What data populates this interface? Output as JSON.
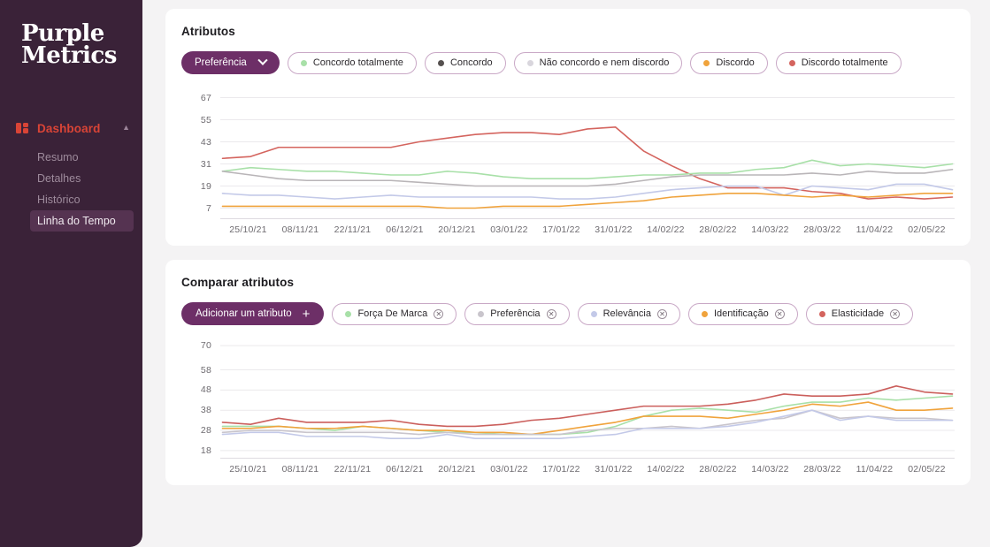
{
  "sidebar": {
    "logo_line1": "Purple",
    "logo_line2": "Metrics",
    "nav": {
      "group_label": "Dashboard",
      "group_icon": "grid-icon",
      "chevron_icon": "chevron-up-icon",
      "items": [
        {
          "label": "Resumo",
          "active": false
        },
        {
          "label": "Detalhes",
          "active": false
        },
        {
          "label": "Histórico",
          "active": false
        },
        {
          "label": "Linha do Tempo",
          "active": true
        }
      ]
    }
  },
  "cards": [
    {
      "title": "Atributos",
      "selector": {
        "label": "Preferência",
        "icon": "chevron-down-icon"
      },
      "legend": [
        {
          "label": "Concordo totalmente",
          "color": "#a8e0a8"
        },
        {
          "label": "Concordo",
          "color": "#55504f"
        },
        {
          "label": "Não concordo e nem discordo",
          "color": "#d9d6dd"
        },
        {
          "label": "Discordo",
          "color": "#f0a33c"
        },
        {
          "label": "Discordo totalmente",
          "color": "#d4645e"
        }
      ]
    },
    {
      "title": "Comparar atributos",
      "selector": {
        "label": "Adicionar um atributo",
        "icon": "plus-icon"
      },
      "legend": [
        {
          "label": "Força De Marca",
          "color": "#a8e0a8",
          "remove_icon": "remove-circle-icon"
        },
        {
          "label": "Preferência",
          "color": "#c9c5cc",
          "remove_icon": "remove-circle-icon"
        },
        {
          "label": "Relevância",
          "color": "#c3c9e8",
          "remove_icon": "remove-circle-icon"
        },
        {
          "label": "Identificação",
          "color": "#f0a33c",
          "remove_icon": "remove-circle-icon"
        },
        {
          "label": "Elasticidade",
          "color": "#d4645e",
          "remove_icon": "remove-circle-icon"
        }
      ]
    }
  ],
  "chart_data": [
    {
      "type": "line",
      "title": "Atributos",
      "xlabel": "",
      "ylabel": "",
      "grid": true,
      "legend_position": "top",
      "yticks": [
        67,
        55,
        43,
        31,
        19,
        7
      ],
      "ylim": [
        1,
        73
      ],
      "x": [
        "25/10/21",
        "01/11/21",
        "08/11/21",
        "15/11/21",
        "22/11/21",
        "29/11/21",
        "06/12/21",
        "13/12/21",
        "20/12/21",
        "27/12/21",
        "03/01/22",
        "10/01/22",
        "17/01/22",
        "24/01/22",
        "31/01/22",
        "07/02/22",
        "14/02/22",
        "21/02/22",
        "28/02/22",
        "07/03/22",
        "14/03/22",
        "21/03/22",
        "28/03/22",
        "04/04/22",
        "11/04/22",
        "18/04/22",
        "02/05/22"
      ],
      "xtick_labels": [
        "25/10/21",
        "08/11/21",
        "22/11/21",
        "06/12/21",
        "20/12/21",
        "03/01/22",
        "17/01/22",
        "31/01/22",
        "14/02/22",
        "28/02/22",
        "14/03/22",
        "28/03/22",
        "11/04/22",
        "02/05/22"
      ],
      "series": [
        {
          "name": "Discordo totalmente",
          "color": "#d4645e",
          "values": [
            34,
            35,
            40,
            40,
            40,
            40,
            40,
            43,
            45,
            47,
            48,
            48,
            47,
            50,
            51,
            38,
            30,
            23,
            18,
            18,
            18,
            16,
            15,
            12,
            13,
            12,
            13
          ]
        },
        {
          "name": "Concordo totalmente",
          "color": "#a8e0a8",
          "values": [
            27,
            29,
            28,
            27,
            27,
            26,
            25,
            25,
            27,
            26,
            24,
            23,
            23,
            23,
            24,
            25,
            25,
            26,
            26,
            28,
            29,
            33,
            30,
            31,
            30,
            29,
            31
          ]
        },
        {
          "name": "Concordo",
          "color": "#b9b5b8",
          "values": [
            27,
            25,
            23,
            22,
            22,
            22,
            22,
            21,
            20,
            19,
            19,
            19,
            19,
            19,
            20,
            22,
            24,
            25,
            25,
            25,
            25,
            26,
            25,
            27,
            26,
            26,
            28
          ]
        },
        {
          "name": "Não concordo e nem discordo",
          "color": "#c3c9e8",
          "values": [
            15,
            14,
            14,
            13,
            12,
            13,
            14,
            13,
            13,
            13,
            13,
            13,
            12,
            12,
            13,
            15,
            17,
            18,
            19,
            19,
            14,
            19,
            18,
            17,
            20,
            20,
            17
          ]
        },
        {
          "name": "Discordo",
          "color": "#f0a33c",
          "values": [
            8,
            8,
            8,
            8,
            8,
            8,
            8,
            8,
            7,
            7,
            8,
            8,
            8,
            9,
            10,
            11,
            13,
            14,
            15,
            15,
            14,
            13,
            14,
            13,
            14,
            15,
            15
          ]
        }
      ]
    },
    {
      "type": "line",
      "title": "Comparar atributos",
      "xlabel": "",
      "ylabel": "",
      "grid": true,
      "legend_position": "top",
      "yticks": [
        70,
        58,
        48,
        38,
        28,
        18
      ],
      "ylim": [
        14,
        74
      ],
      "x": [
        "25/10/21",
        "01/11/21",
        "08/11/21",
        "15/11/21",
        "22/11/21",
        "29/11/21",
        "06/12/21",
        "13/12/21",
        "20/12/21",
        "27/12/21",
        "03/01/22",
        "10/01/22",
        "17/01/22",
        "24/01/22",
        "31/01/22",
        "07/02/22",
        "14/02/22",
        "21/02/22",
        "28/02/22",
        "07/03/22",
        "14/03/22",
        "21/03/22",
        "28/03/22",
        "04/04/22",
        "11/04/22",
        "18/04/22",
        "02/05/22"
      ],
      "xtick_labels": [
        "25/10/21",
        "08/11/21",
        "22/11/21",
        "06/12/21",
        "20/12/21",
        "03/01/22",
        "17/01/22",
        "31/01/22",
        "14/02/22",
        "28/02/22",
        "14/03/22",
        "28/03/22",
        "11/04/22",
        "02/05/22"
      ],
      "series": [
        {
          "name": "Elasticidade",
          "color": "#cb5f5c",
          "values": [
            32,
            31,
            34,
            32,
            32,
            32,
            33,
            31,
            30,
            30,
            31,
            33,
            34,
            36,
            38,
            40,
            40,
            40,
            41,
            43,
            46,
            45,
            45,
            46,
            50,
            47,
            46
          ]
        },
        {
          "name": "Força De Marca",
          "color": "#a8e0a8",
          "values": [
            30,
            30,
            30,
            29,
            28,
            30,
            29,
            28,
            27,
            27,
            26,
            26,
            26,
            27,
            30,
            35,
            38,
            39,
            38,
            37,
            40,
            42,
            42,
            44,
            43,
            44,
            45
          ]
        },
        {
          "name": "Identificação",
          "color": "#f0a33c",
          "values": [
            29,
            29,
            30,
            29,
            29,
            30,
            29,
            28,
            28,
            27,
            27,
            26,
            28,
            30,
            32,
            35,
            35,
            35,
            34,
            36,
            38,
            41,
            40,
            42,
            38,
            38,
            39
          ]
        },
        {
          "name": "Preferência",
          "color": "#c9c5cc",
          "values": [
            27,
            28,
            28,
            27,
            27,
            27,
            27,
            26,
            27,
            26,
            26,
            26,
            26,
            28,
            29,
            29,
            30,
            29,
            31,
            33,
            34,
            38,
            34,
            35,
            34,
            34,
            33
          ]
        },
        {
          "name": "Relevância",
          "color": "#c3c9e8",
          "values": [
            26,
            27,
            27,
            25,
            25,
            25,
            24,
            24,
            26,
            24,
            24,
            24,
            24,
            25,
            26,
            29,
            29,
            29,
            30,
            32,
            35,
            38,
            33,
            35,
            33,
            33,
            33
          ]
        }
      ]
    }
  ]
}
